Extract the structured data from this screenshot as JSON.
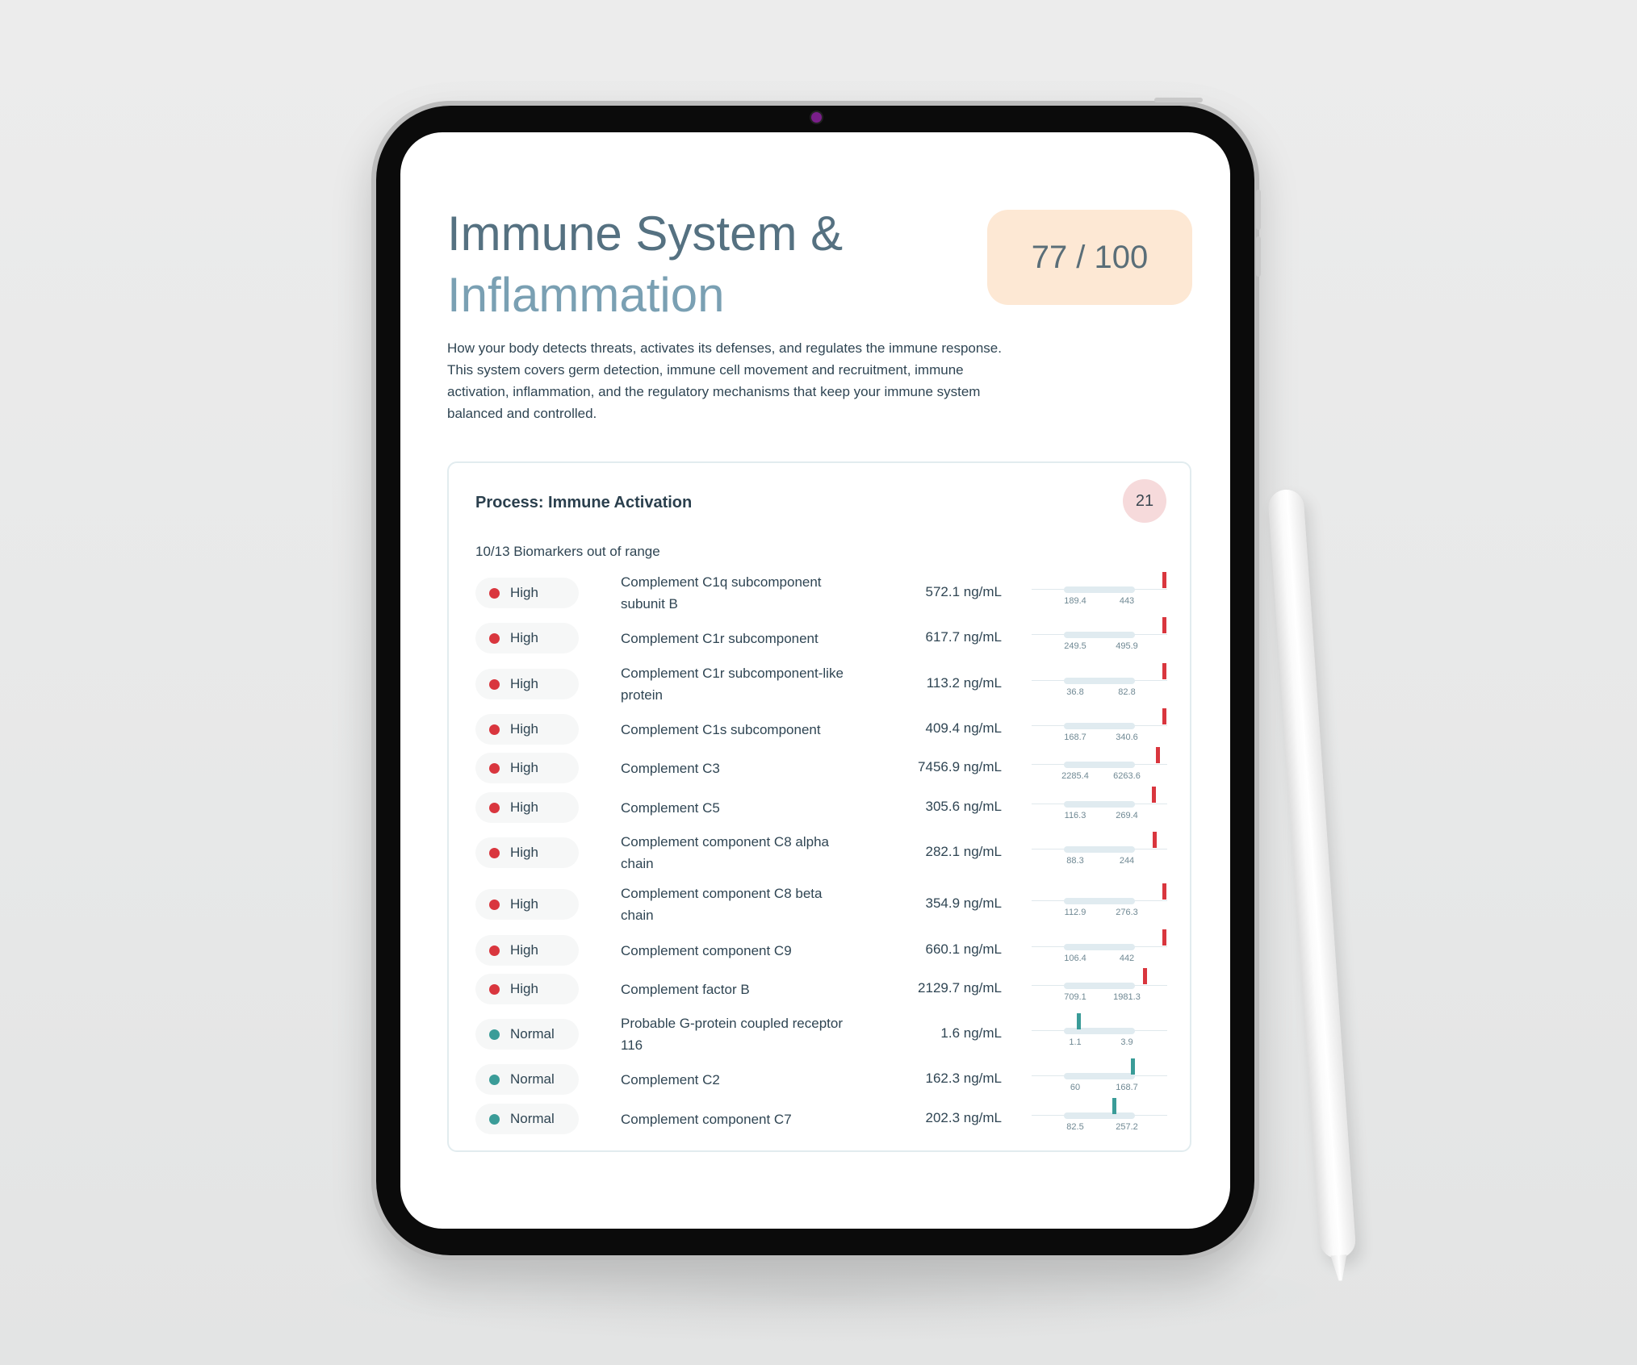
{
  "page": {
    "title_line1": "Immune System &",
    "title_line2": "Inflammation",
    "score": "77 / 100",
    "description": "How your body detects threats, activates its defenses, and regulates the immune response. This system covers germ detection, immune cell movement and recruitment, immune activation, inflammation, and the regulatory mechanisms that keep your immune system balanced and controlled."
  },
  "colors": {
    "high": "#d9363e",
    "normal": "#3a9c98"
  },
  "process": {
    "title": "Process: Immune Activation",
    "count_badge": "21",
    "summary": "10/13 Biomarkers out of range",
    "biomarkers": [
      {
        "status": "High",
        "name": "Complement C1q subcomponent subunit B",
        "value": "572.1 ng/mL",
        "range_low": "189.4",
        "range_high": "443"
      },
      {
        "status": "High",
        "name": "Complement C1r subcomponent",
        "value": "617.7 ng/mL",
        "range_low": "249.5",
        "range_high": "495.9"
      },
      {
        "status": "High",
        "name": "Complement C1r subcomponent-like protein",
        "value": "113.2 ng/mL",
        "range_low": "36.8",
        "range_high": "82.8"
      },
      {
        "status": "High",
        "name": "Complement C1s subcomponent",
        "value": "409.4 ng/mL",
        "range_low": "168.7",
        "range_high": "340.6"
      },
      {
        "status": "High",
        "name": "Complement C3",
        "value": "7456.9 ng/mL",
        "range_low": "2285.4",
        "range_high": "6263.6"
      },
      {
        "status": "High",
        "name": "Complement C5",
        "value": "305.6 ng/mL",
        "range_low": "116.3",
        "range_high": "269.4"
      },
      {
        "status": "High",
        "name": "Complement component C8 alpha chain",
        "value": "282.1 ng/mL",
        "range_low": "88.3",
        "range_high": "244"
      },
      {
        "status": "High",
        "name": "Complement component C8 beta chain",
        "value": "354.9 ng/mL",
        "range_low": "112.9",
        "range_high": "276.3"
      },
      {
        "status": "High",
        "name": "Complement component C9",
        "value": "660.1 ng/mL",
        "range_low": "106.4",
        "range_high": "442"
      },
      {
        "status": "High",
        "name": "Complement factor B",
        "value": "2129.7 ng/mL",
        "range_low": "709.1",
        "range_high": "1981.3"
      },
      {
        "status": "Normal",
        "name": "Probable G-protein coupled receptor 116",
        "value": "1.6 ng/mL",
        "range_low": "1.1",
        "range_high": "3.9"
      },
      {
        "status": "Normal",
        "name": "Complement C2",
        "value": "162.3 ng/mL",
        "range_low": "60",
        "range_high": "168.7"
      },
      {
        "status": "Normal",
        "name": "Complement component C7",
        "value": "202.3 ng/mL",
        "range_low": "82.5",
        "range_high": "257.2"
      }
    ]
  }
}
